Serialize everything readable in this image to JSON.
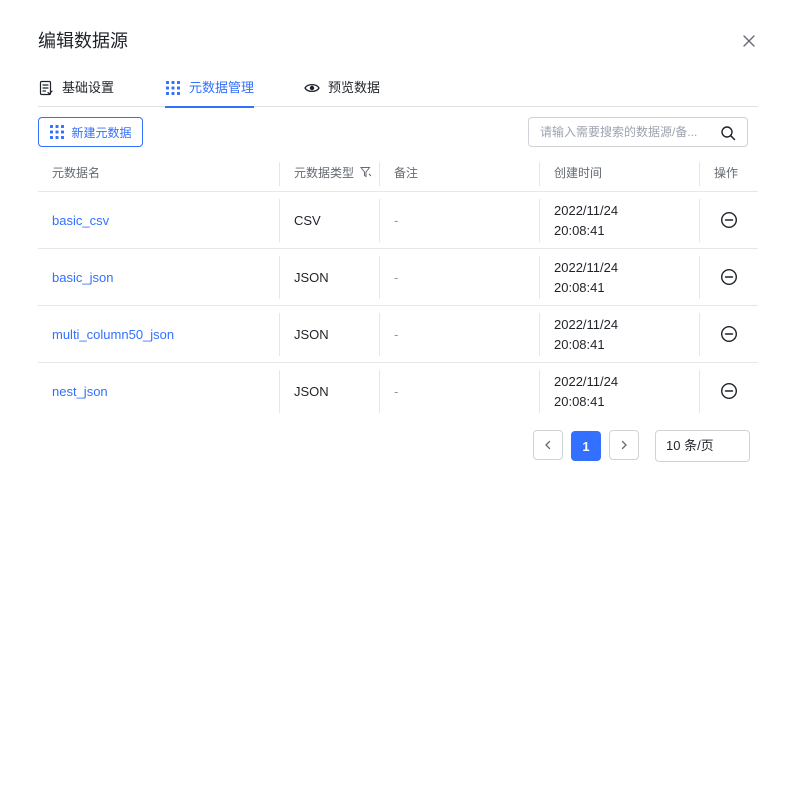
{
  "dialog": {
    "title": "编辑数据源"
  },
  "tabs": [
    {
      "label": "基础设置",
      "icon": "settings-doc-icon",
      "active": false
    },
    {
      "label": "元数据管理",
      "icon": "grid-icon",
      "active": true
    },
    {
      "label": "预览数据",
      "icon": "eye-icon",
      "active": false
    }
  ],
  "toolbar": {
    "new_button_label": "新建元数据",
    "search_placeholder": "请输入需要搜索的数据源/备..."
  },
  "table": {
    "columns": [
      "元数据名",
      "元数据类型",
      "备注",
      "创建时间",
      "操作"
    ],
    "rows": [
      {
        "name": "basic_csv",
        "type": "CSV",
        "note": "-",
        "date": "2022/11/24",
        "time": "20:08:41"
      },
      {
        "name": "basic_json",
        "type": "JSON",
        "note": "-",
        "date": "2022/11/24",
        "time": "20:08:41"
      },
      {
        "name": "multi_column50_json",
        "type": "JSON",
        "note": "-",
        "date": "2022/11/24",
        "time": "20:08:41"
      },
      {
        "name": "nest_json",
        "type": "JSON",
        "note": "-",
        "date": "2022/11/24",
        "time": "20:08:41"
      }
    ]
  },
  "pagination": {
    "current_page": "1",
    "page_size_label": "10 条/页"
  },
  "colors": {
    "accent": "#3370ff",
    "text": "#1f2329",
    "muted": "#646a73",
    "border": "#e5e6eb"
  }
}
